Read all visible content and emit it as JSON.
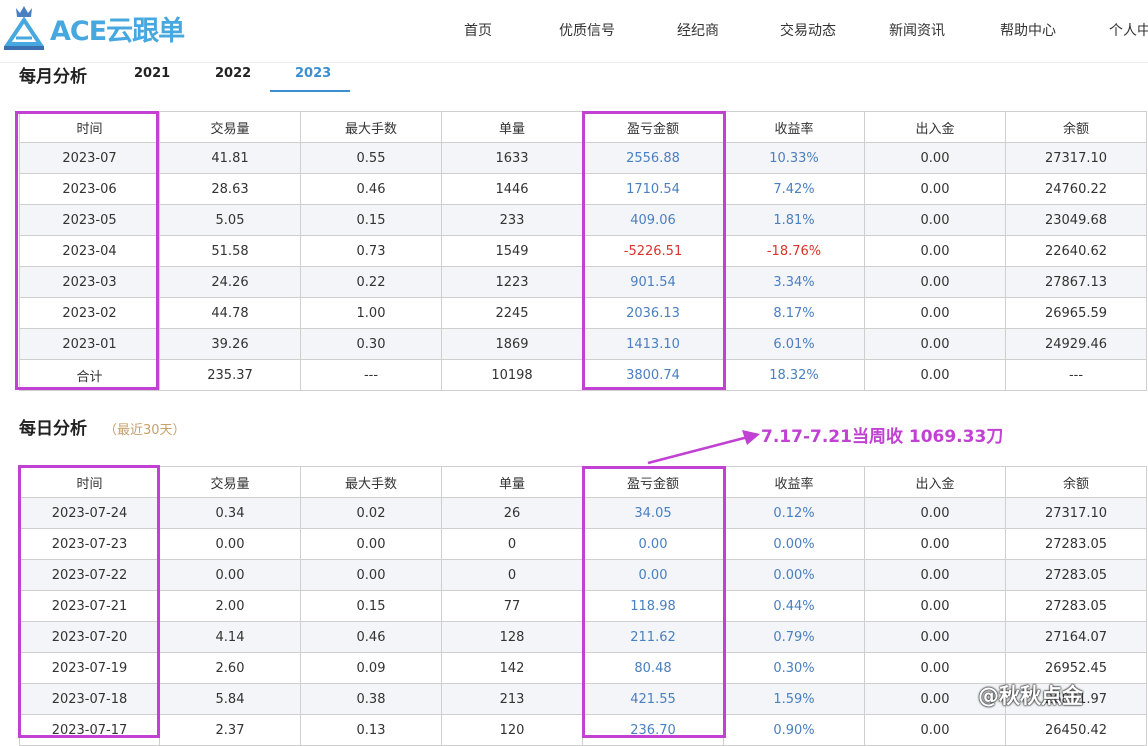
{
  "brand": {
    "name": "ACE云跟单",
    "accent": "#47a8e0"
  },
  "nav": [
    "首页",
    "优质信号",
    "经纪商",
    "交易动态",
    "新闻资讯",
    "帮助中心",
    "个人中"
  ],
  "monthly": {
    "title": "每月分析",
    "years": [
      "2021",
      "2022",
      "2023"
    ],
    "active_year": "2023",
    "columns": [
      "时间",
      "交易量",
      "最大手数",
      "单量",
      "盈亏金额",
      "收益率",
      "出入金",
      "余额"
    ],
    "rows": [
      [
        "2023-07",
        "41.81",
        "0.55",
        "1633",
        "2556.88",
        "10.33%",
        "0.00",
        "27317.10"
      ],
      [
        "2023-06",
        "28.63",
        "0.46",
        "1446",
        "1710.54",
        "7.42%",
        "0.00",
        "24760.22"
      ],
      [
        "2023-05",
        "5.05",
        "0.15",
        "233",
        "409.06",
        "1.81%",
        "0.00",
        "23049.68"
      ],
      [
        "2023-04",
        "51.58",
        "0.73",
        "1549",
        "-5226.51",
        "-18.76%",
        "0.00",
        "22640.62"
      ],
      [
        "2023-03",
        "24.26",
        "0.22",
        "1223",
        "901.54",
        "3.34%",
        "0.00",
        "27867.13"
      ],
      [
        "2023-02",
        "44.78",
        "1.00",
        "2245",
        "2036.13",
        "8.17%",
        "0.00",
        "26965.59"
      ],
      [
        "2023-01",
        "39.26",
        "0.30",
        "1869",
        "1413.10",
        "6.01%",
        "0.00",
        "24929.46"
      ],
      [
        "合计",
        "235.37",
        "---",
        "10198",
        "3800.74",
        "18.32%",
        "0.00",
        "---"
      ]
    ]
  },
  "daily": {
    "title": "每日分析",
    "subtitle": "（最近30天）",
    "columns": [
      "时间",
      "交易量",
      "最大手数",
      "单量",
      "盈亏金额",
      "收益率",
      "出入金",
      "余额"
    ],
    "rows": [
      [
        "2023-07-24",
        "0.34",
        "0.02",
        "26",
        "34.05",
        "0.12%",
        "0.00",
        "27317.10"
      ],
      [
        "2023-07-23",
        "0.00",
        "0.00",
        "0",
        "0.00",
        "0.00%",
        "0.00",
        "27283.05"
      ],
      [
        "2023-07-22",
        "0.00",
        "0.00",
        "0",
        "0.00",
        "0.00%",
        "0.00",
        "27283.05"
      ],
      [
        "2023-07-21",
        "2.00",
        "0.15",
        "77",
        "118.98",
        "0.44%",
        "0.00",
        "27283.05"
      ],
      [
        "2023-07-20",
        "4.14",
        "0.46",
        "128",
        "211.62",
        "0.79%",
        "0.00",
        "27164.07"
      ],
      [
        "2023-07-19",
        "2.60",
        "0.09",
        "142",
        "80.48",
        "0.30%",
        "0.00",
        "26952.45"
      ],
      [
        "2023-07-18",
        "5.84",
        "0.38",
        "213",
        "421.55",
        "1.59%",
        "0.00",
        "26871.97"
      ],
      [
        "2023-07-17",
        "2.37",
        "0.13",
        "120",
        "236.70",
        "0.90%",
        "0.00",
        "26450.42"
      ]
    ]
  },
  "annotation": "7.17-7.21当周收  1069.33刀",
  "watermark": "@秋秋点金",
  "colors": {
    "positive": "#4a7fc0",
    "negative": "#d9332b",
    "highlight": "#c141d3",
    "tab_active": "#3a8fd0"
  }
}
